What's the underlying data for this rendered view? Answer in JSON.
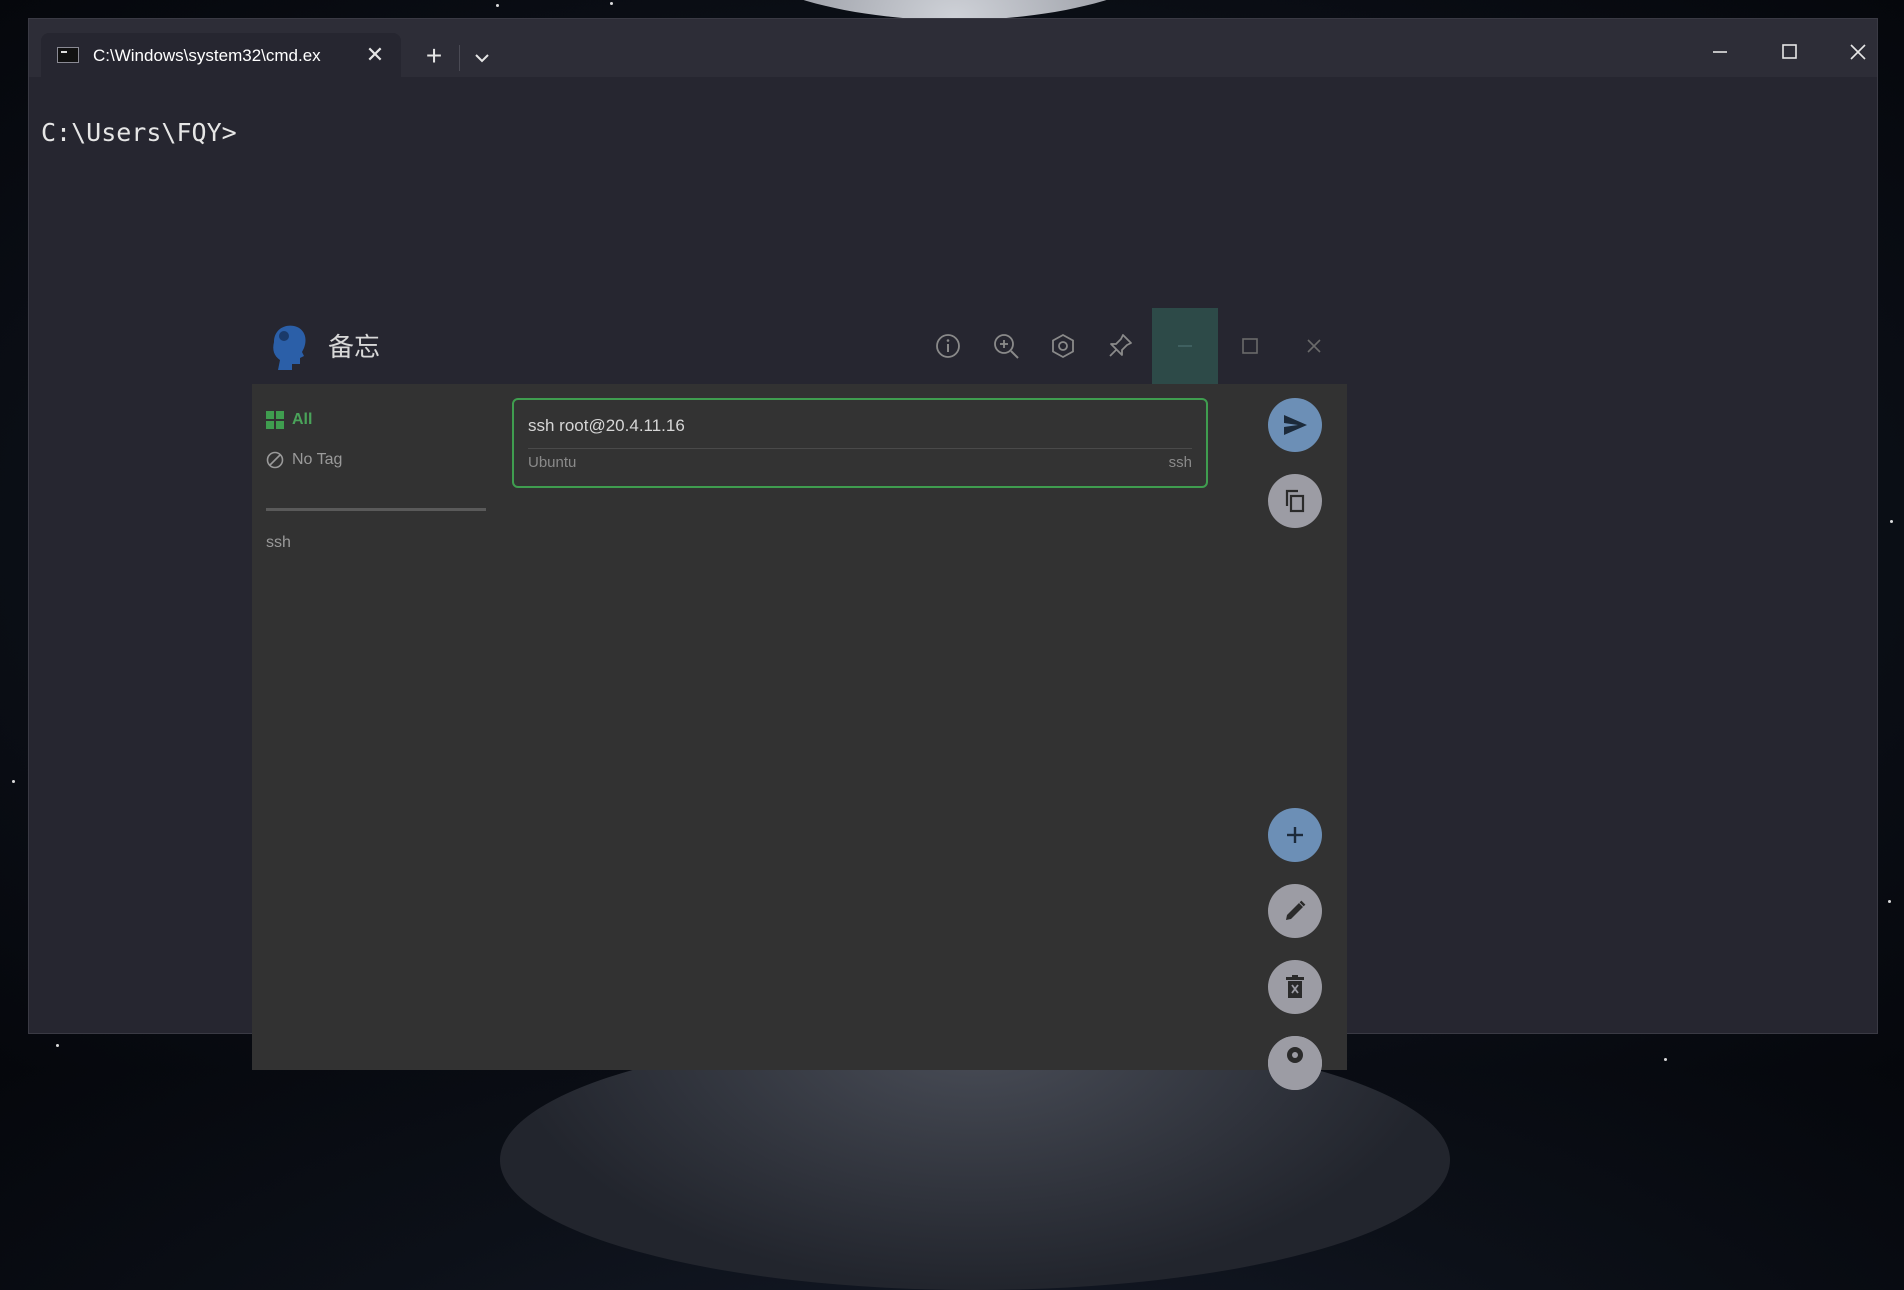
{
  "terminal": {
    "tab_title": "C:\\Windows\\system32\\cmd.ex",
    "prompt": "C:\\Users\\FQY>"
  },
  "memo": {
    "title": "备忘",
    "sidebar": {
      "all_label": "All",
      "no_tag_label": "No Tag",
      "tags": [
        "ssh"
      ]
    },
    "notes": [
      {
        "content": "ssh root@20.4.11.16",
        "subtitle": "Ubuntu",
        "tag": "ssh"
      }
    ]
  },
  "colors": {
    "accent_green": "#3f9d4f",
    "fab_blue": "#6c8fb6",
    "fab_gray": "#9c9ca4"
  },
  "icons": {
    "header": [
      "info-icon",
      "zoom-in-icon",
      "settings-hex-icon",
      "pin-icon",
      "minimize-icon",
      "maximize-icon",
      "close-icon"
    ],
    "fabs": [
      "send-icon",
      "copy-icon",
      "add-icon",
      "edit-icon",
      "delete-icon",
      "check-all-icon",
      "gear-icon"
    ]
  }
}
